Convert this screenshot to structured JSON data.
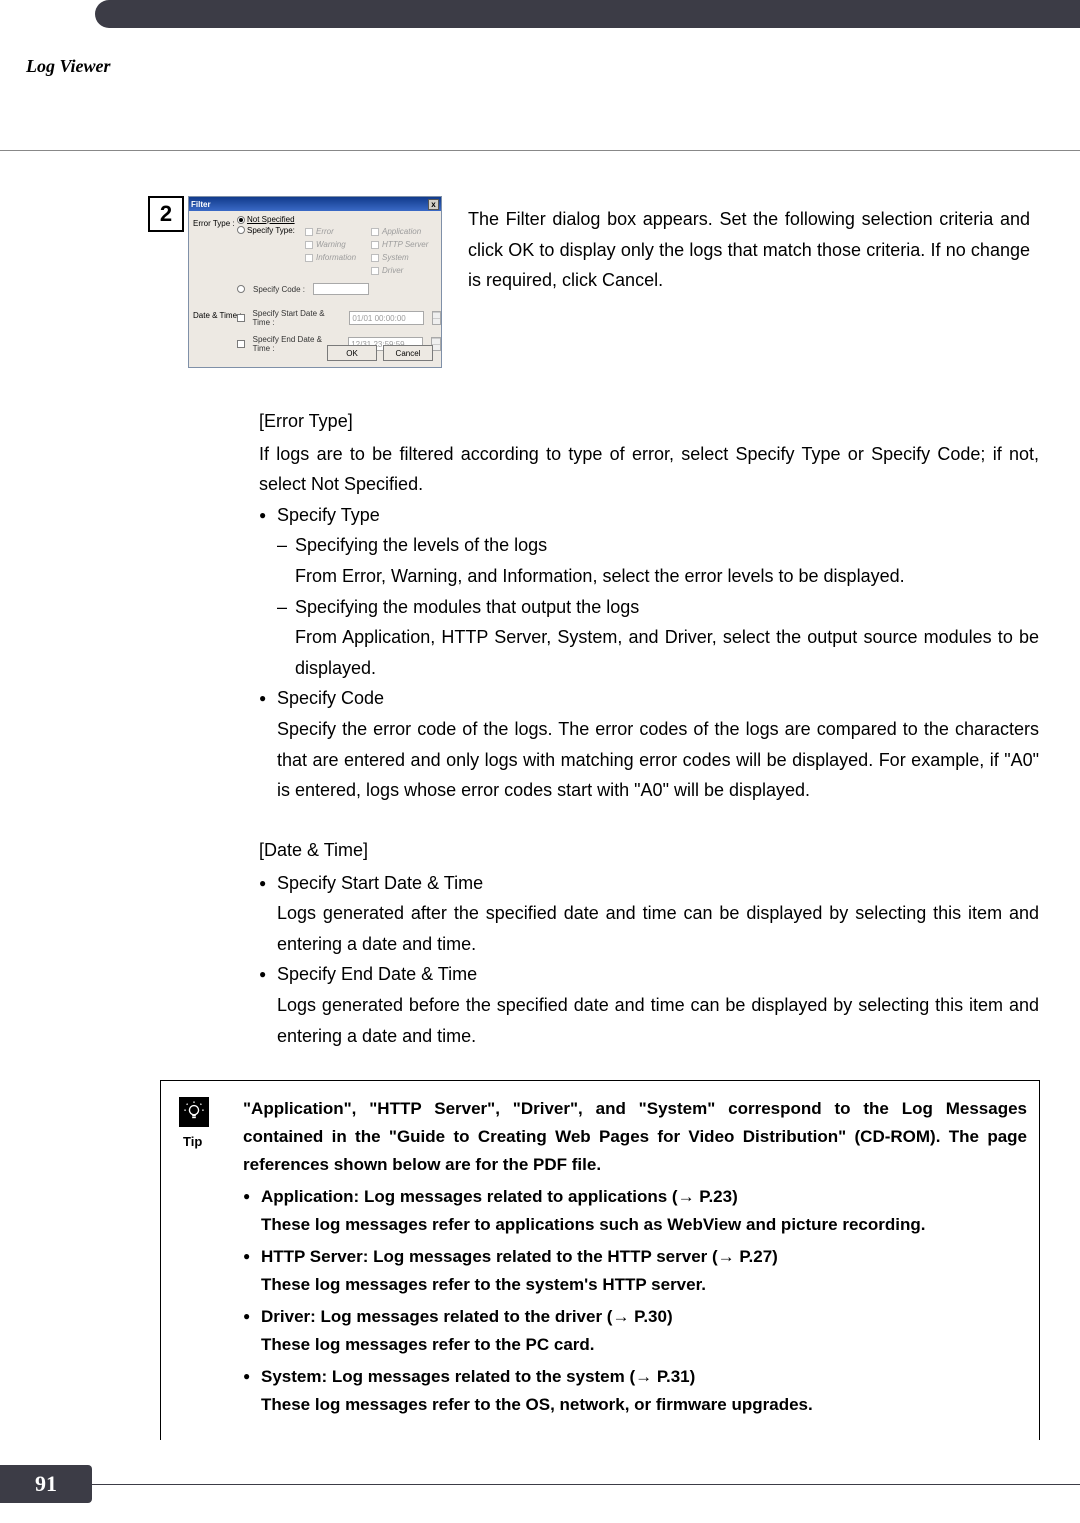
{
  "header": {
    "running_title": "Log Viewer"
  },
  "step": {
    "number": "2"
  },
  "dialog": {
    "title": "Filter",
    "close_glyph": "x",
    "labels": {
      "error_type": "Error Type :",
      "date_time": "Date & Time :",
      "not_specified": "Not Specified",
      "specify_type": "Specify Type:",
      "specify_code": "Specify Code :",
      "specify_start": "Specify Start Date & Time :",
      "specify_end": "Specify End Date & Time :"
    },
    "options": {
      "error": "Error",
      "warning": "Warning",
      "information": "Information",
      "application": "Application",
      "http_server": "HTTP Server",
      "system": "System",
      "driver": "Driver"
    },
    "values": {
      "start": "01/01 00:00:00",
      "end": "12/31 23:59:59"
    },
    "buttons": {
      "ok": "OK",
      "cancel": "Cancel"
    }
  },
  "intro_para": "The Filter dialog box appears. Set the following selection criteria and click OK to display only the logs that match those criteria. If no change is required, click Cancel.",
  "error_type_section": {
    "title": "[Error Type]",
    "lead": "If logs are to be filtered according to type of error, select Specify Type or Specify Code; if not, select Not Specified.",
    "specify_type_head": "Specify Type",
    "lvl2a_head": "Specifying the levels of the logs",
    "lvl2a_body": "From Error, Warning, and Information, select the error levels to be displayed.",
    "lvl2b_head": "Specifying the modules that output the logs",
    "lvl2b_body": "From Application, HTTP Server, System, and Driver, select the output source modules to be displayed.",
    "specify_code_head": "Specify Code",
    "specify_code_body": "Specify the error code of the logs. The error codes of the logs are compared to the characters that are entered and only logs with matching error codes will be displayed. For example, if \"A0\" is entered, logs whose error codes start with \"A0\" will be displayed."
  },
  "datetime_section": {
    "title": "[Date & Time]",
    "start_head": "Specify Start Date & Time",
    "start_body": "Logs generated after the specified date and time can be displayed by selecting this item and entering a date and time.",
    "end_head": "Specify End Date & Time",
    "end_body": "Logs generated before the specified date and time can be displayed by selecting this item and entering a date and time."
  },
  "tip": {
    "label": "Tip",
    "intro": "\"Application\", \"HTTP Server\", \"Driver\", and \"System\" correspond to the Log Messages contained in the \"Guide to Creating Web Pages for Video Distribution\" (CD-ROM). The page references shown below are for the PDF file.",
    "items": [
      {
        "head": "Application: Log messages related to applications (→ P.23)",
        "body": "These log messages refer to applications such as WebView and picture recording."
      },
      {
        "head": "HTTP Server: Log messages related to the HTTP server (→ P.27)",
        "body": "These log messages refer to the system's HTTP server."
      },
      {
        "head": "Driver: Log messages related to the driver (→ P.30)",
        "body": "These log messages refer to the PC card."
      },
      {
        "head": "System: Log messages related to the system (→ P.31)",
        "body": "These log messages refer to the OS, network, or firmware upgrades."
      }
    ]
  },
  "page_number": "91"
}
